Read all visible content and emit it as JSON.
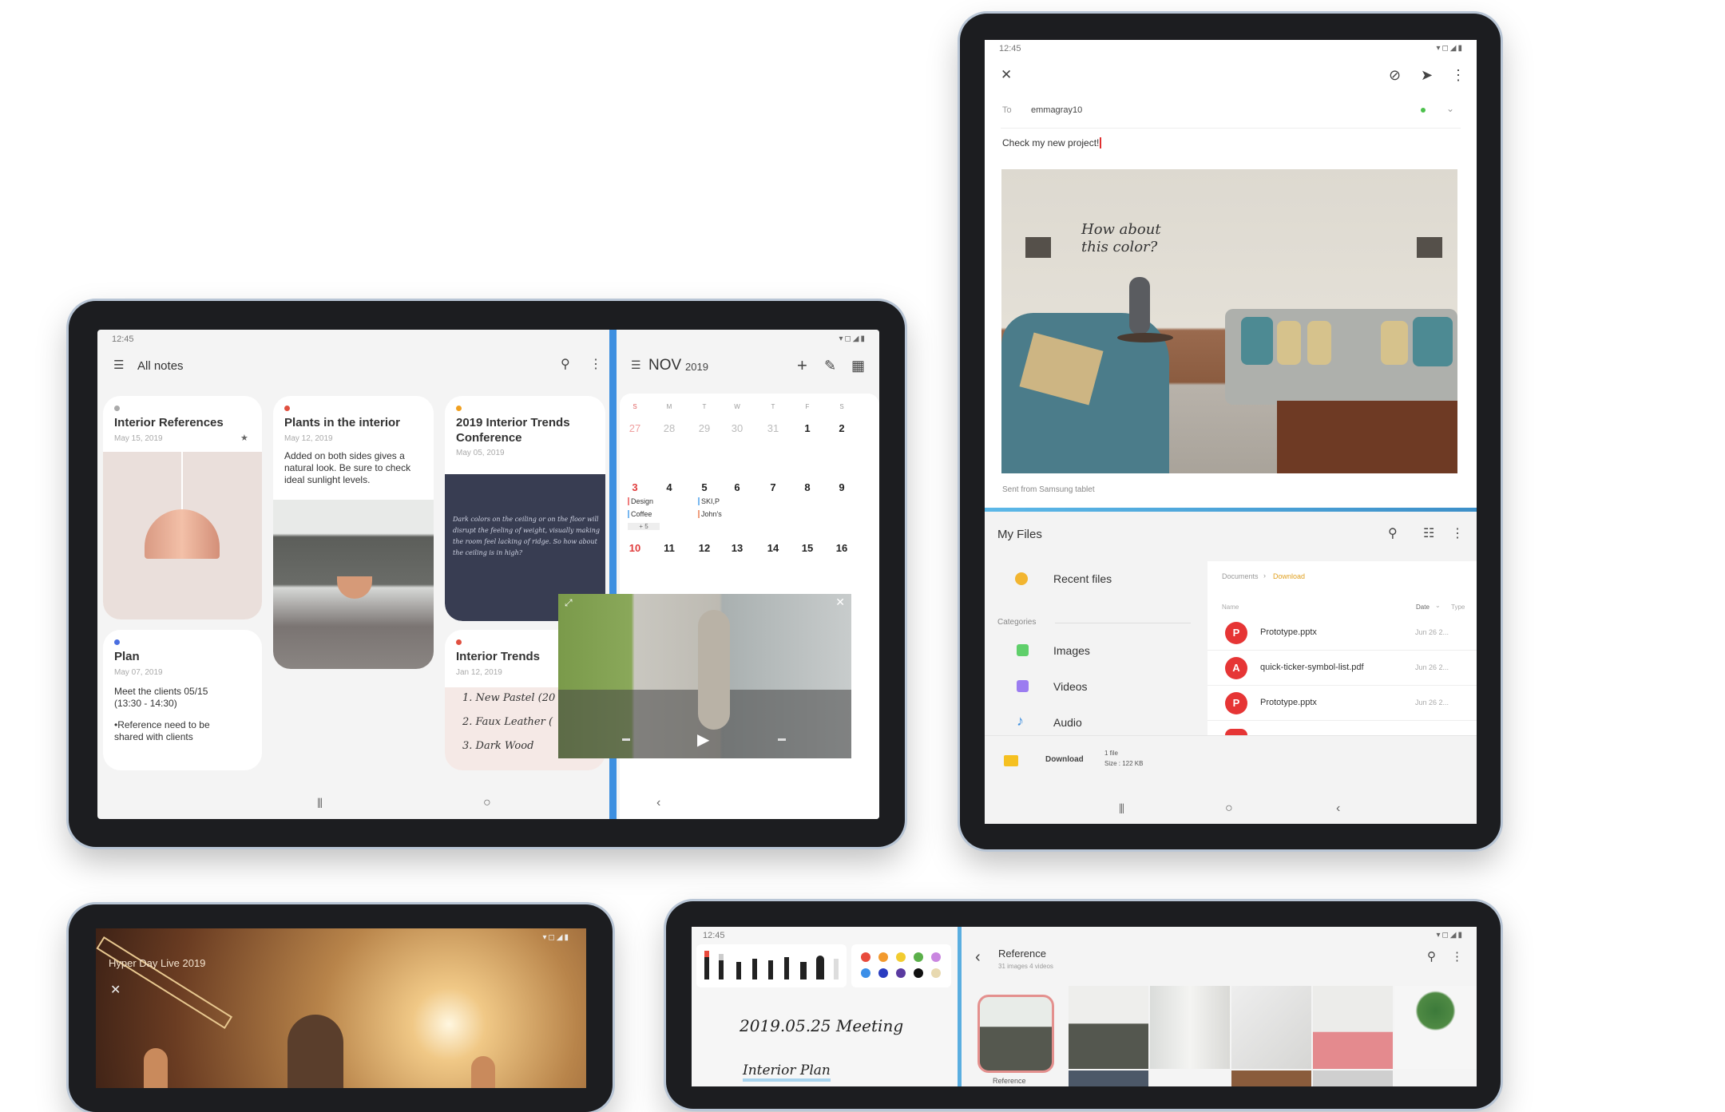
{
  "notes_tablet": {
    "status_time": "12:45",
    "header_title": "All notes",
    "notes": [
      {
        "title": "Interior References",
        "date": "May 15, 2019",
        "dot_color": "#aaaaaa"
      },
      {
        "title": "Plants in the interior",
        "date": "May 12, 2019",
        "body": "Added on both sides gives a natural look. Be sure to check ideal sunlight levels.",
        "dot_color": "#e05040"
      },
      {
        "title": "2019 Interior Trends Conference",
        "date": "May 05, 2019",
        "body": "Dark colors on the ceiling or on the floor will disrupt the feeling of weight, visually making the room feel lacking of ridge. So how about the ceiling is in high?",
        "dot_color": "#f0a020"
      },
      {
        "title": "Plan",
        "date": "May 07, 2019",
        "body1": "Meet the clients 05/15 (13:30 - 14:30)",
        "body2": "•Reference need to be shared with clients",
        "dot_color": "#4a6ee0"
      },
      {
        "title": "Interior Trends",
        "date": "Jan 12, 2019",
        "list": [
          "1. New Pastel (20",
          "2. Faux Leather (",
          "3. Dark Wood"
        ],
        "dot_color": "#e05040"
      }
    ],
    "calendar": {
      "month": "NOV",
      "year": "2019",
      "weekdays": [
        "S",
        "M",
        "T",
        "W",
        "T",
        "F",
        "S"
      ],
      "weeks": [
        [
          "27",
          "28",
          "29",
          "30",
          "31",
          "1",
          "2"
        ],
        [
          "3",
          "4",
          "5",
          "6",
          "7",
          "8",
          "9"
        ],
        [
          "10",
          "11",
          "12",
          "13",
          "14",
          "15",
          "16"
        ]
      ],
      "events": {
        "sun3": [
          "Design",
          "Coffee"
        ],
        "more": "+ 5",
        "tue5": [
          "SKI,P",
          "John's"
        ]
      }
    },
    "accent": "#3d8fe0"
  },
  "email_tablet": {
    "status_time": "12:45",
    "to_label": "To",
    "to_value": "emmagray10",
    "subject": "Check my new project!",
    "annotation": "How about this color?",
    "signature": "Sent from Samsung tablet",
    "files": {
      "title": "My Files",
      "recent": "Recent files",
      "categories_label": "Categories",
      "categories": [
        "Images",
        "Videos",
        "Audio"
      ],
      "breadcrumb_parent": "Documents",
      "breadcrumb_current": "Download",
      "col_name": "Name",
      "col_date": "Date",
      "col_type": "Type",
      "rows": [
        {
          "name": "Prototype.pptx",
          "date": "Jun 26 2..."
        },
        {
          "name": "quick-ticker-symbol-list.pdf",
          "date": "Jun 26 2..."
        },
        {
          "name": "Prototype.pptx",
          "date": "Jun 26 2..."
        }
      ],
      "footer_folder": "Download",
      "footer_count": "1 file",
      "footer_size": "Size : 122 KB"
    }
  },
  "video_tablet": {
    "title": "Hyper Day Live 2019"
  },
  "gallery_tablet": {
    "status_time": "12:45",
    "note_title": "2019.05.25 Meeting",
    "note_sub": "Interior Plan",
    "album_title": "Reference",
    "album_sub": "31 images 4 videos",
    "album_label": "Reference",
    "pen_colors": [
      "#e84a3c",
      "#f29a2e",
      "#f2cc30",
      "#5bb04a",
      "#c986e0",
      "#3b8fe8",
      "#2a3cc0",
      "#5a3aa0",
      "#111111",
      "#e8d9b0"
    ]
  }
}
